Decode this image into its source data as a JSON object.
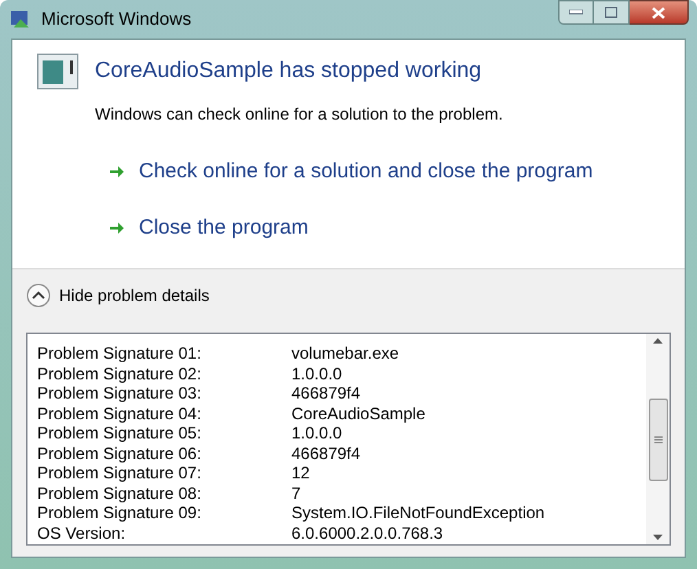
{
  "window": {
    "title": "Microsoft Windows"
  },
  "heading": "CoreAudioSample has stopped working",
  "message": "Windows can check online for a solution to the problem.",
  "options": [
    {
      "label": "Check online for a solution and close the program"
    },
    {
      "label": "Close the program"
    }
  ],
  "details_toggle": {
    "label": "Hide problem details",
    "expanded": true
  },
  "details": [
    {
      "name": "Problem Signature 01:",
      "value": "volumebar.exe"
    },
    {
      "name": "Problem Signature 02:",
      "value": "1.0.0.0"
    },
    {
      "name": "Problem Signature 03:",
      "value": "466879f4"
    },
    {
      "name": "Problem Signature 04:",
      "value": "CoreAudioSample"
    },
    {
      "name": "Problem Signature 05:",
      "value": "1.0.0.0"
    },
    {
      "name": "Problem Signature 06:",
      "value": "466879f4"
    },
    {
      "name": "Problem Signature 07:",
      "value": "12"
    },
    {
      "name": "Problem Signature 08:",
      "value": "7"
    },
    {
      "name": "Problem Signature 09:",
      "value": "System.IO.FileNotFoundException"
    },
    {
      "name": "OS Version:",
      "value": "6.0.6000.2.0.0.768.3"
    }
  ]
}
